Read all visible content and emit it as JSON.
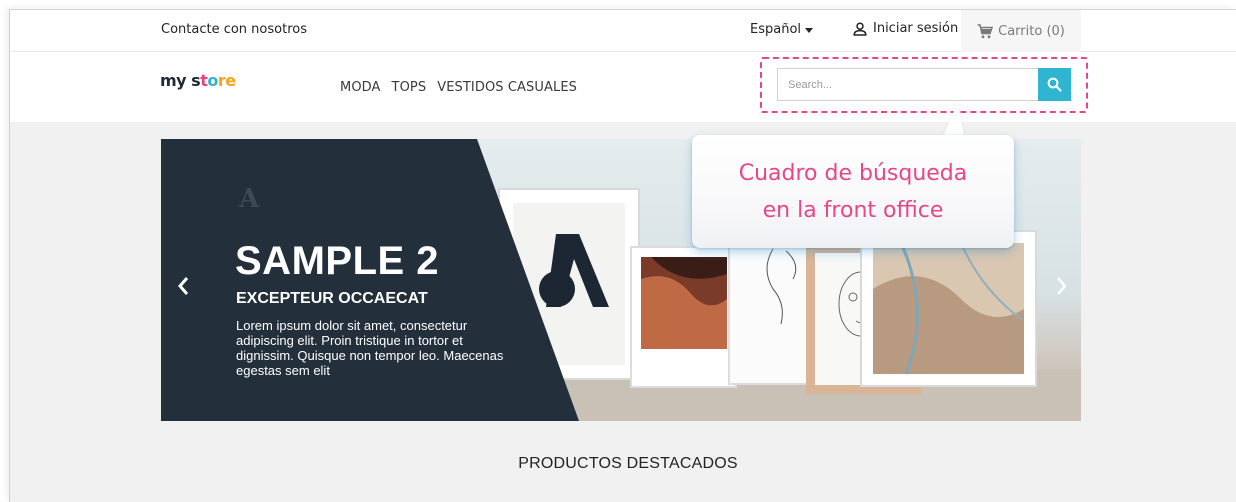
{
  "topbar": {
    "contact": "Contacte con nosotros",
    "language": "Español",
    "login": "Iniciar sesión",
    "cart": "Carrito (0)"
  },
  "header": {
    "logo": {
      "part1": "my s",
      "part2": "t",
      "part3": "o",
      "part4": "re"
    },
    "nav": [
      "MODA",
      "TOPS",
      "VESTIDOS CASUALES"
    ],
    "search": {
      "placeholder": "Search..."
    }
  },
  "slider": {
    "title": "SAMPLE 2",
    "subtitle": "EXCEPTEUR OCCAECAT",
    "text": "Lorem ipsum dolor sit amet, consectetur adipiscing elit. Proin tristique in tortor et dignissim. Quisque non tempor leo. Maecenas egestas sem elit"
  },
  "callout": {
    "line1": "Cuadro de búsqueda",
    "line2": "en la front office"
  },
  "section": {
    "title": "PRODUCTOS DESTACADOS"
  },
  "colors": {
    "accent": "#2fb5d2",
    "highlight": "#e6468a",
    "slide_dark": "#232f3b"
  },
  "icons": [
    "caret-down-icon",
    "user-icon",
    "cart-icon",
    "search-icon",
    "chevron-left-icon",
    "chevron-right-icon"
  ]
}
